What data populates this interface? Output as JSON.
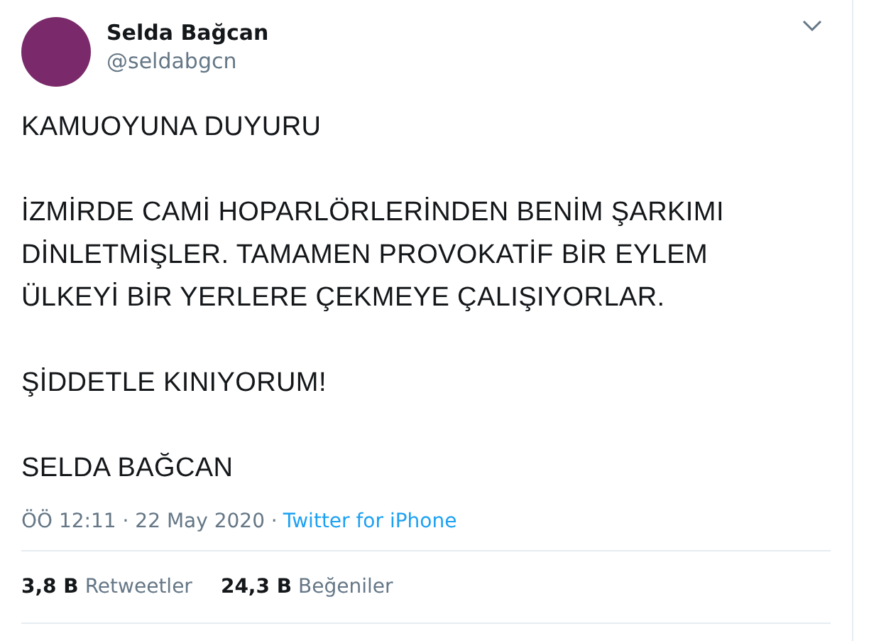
{
  "author": {
    "name": "Selda Bağcan",
    "handle": "@seldabgcn"
  },
  "tweet": {
    "paragraphs": [
      [
        "KAMUOYUNA DUYURU"
      ],
      [
        "İZMİRDE CAMİ HOPARLÖRLERİNDEN BENİM ŞARKIMI",
        "DİNLETMİŞLER. TAMAMEN PROVOKATİF BİR EYLEM",
        "ÜLKEYİ BİR YERLERE ÇEKMEYE ÇALIŞIYORLAR."
      ],
      [
        "ŞİDDETLE KINIYORUM!"
      ],
      [
        "SELDA BAĞCAN"
      ]
    ]
  },
  "meta": {
    "time": "ÖÖ 12:11 · 22 May 2020 ·",
    "source": "Twitter for iPhone"
  },
  "stats": [
    {
      "count": "3,8 B",
      "label": "Retweetler"
    },
    {
      "count": "24,3 B",
      "label": "Beğeniler"
    }
  ]
}
